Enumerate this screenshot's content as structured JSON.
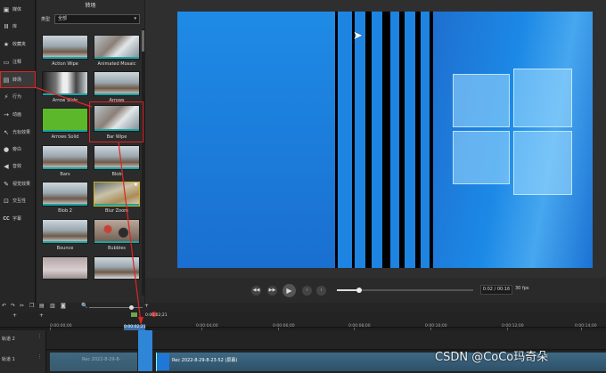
{
  "nav": {
    "items": [
      {
        "icon": "media-icon",
        "glyph": "▣",
        "label": "媒体"
      },
      {
        "icon": "library-icon",
        "glyph": "Ⅲ",
        "label": "库"
      },
      {
        "icon": "favorites-icon",
        "glyph": "★",
        "label": "收藏夹"
      },
      {
        "icon": "annotation-icon",
        "glyph": "▭",
        "label": "注释"
      },
      {
        "icon": "transition-icon",
        "glyph": "▤",
        "label": "转场"
      },
      {
        "icon": "behavior-icon",
        "glyph": "⚡",
        "label": "行为"
      },
      {
        "icon": "animation-icon",
        "glyph": "→",
        "label": "动画"
      },
      {
        "icon": "cursor-effect-icon",
        "glyph": "↖",
        "label": "光标效果"
      },
      {
        "icon": "narration-icon",
        "glyph": "●",
        "label": "旁白"
      },
      {
        "icon": "audio-icon",
        "glyph": "◀",
        "label": "音效"
      },
      {
        "icon": "visual-effect-icon",
        "glyph": "✎",
        "label": "视觉效果"
      },
      {
        "icon": "interactivity-icon",
        "glyph": "⊡",
        "label": "交互性"
      },
      {
        "icon": "captions-icon",
        "glyph": "CC",
        "label": "字幕"
      }
    ]
  },
  "panel": {
    "title": "转场",
    "type_label": "类型",
    "type_value": "全部",
    "tiles": [
      {
        "label": "Action Wipe"
      },
      {
        "label": "Animated Mosaic"
      },
      {
        "label": "Arrow Slide"
      },
      {
        "label": "Arrows"
      },
      {
        "label": "Arrows Solid"
      },
      {
        "label": "Bar Wipe"
      },
      {
        "label": "Bars"
      },
      {
        "label": "Blob"
      },
      {
        "label": "Blob 2"
      },
      {
        "label": "Blur Zoom"
      },
      {
        "label": "Bounce"
      },
      {
        "label": "Bubbles"
      }
    ]
  },
  "transport": {
    "time": "0:02 / 00:16",
    "fps": "30 fps"
  },
  "timeline": {
    "playhead": "0:00:02;21",
    "playhead_short": "0:00:02;21",
    "ruler_ticks": [
      "0:00:00;00",
      "0:00:02;00",
      "0:00:04;00",
      "0:00:06;00",
      "0:00:08;00",
      "0:00:10;00",
      "0:00:12;00",
      "0:00:14;00"
    ],
    "tracks": [
      {
        "name": "轨道 2"
      },
      {
        "name": "轨道 1"
      }
    ],
    "clip_pre_label": "Rec 2022-8-29-8-",
    "clip_main_label": "Rec 2022-8-29-8-23-52 (屏幕)"
  },
  "watermark": "CSDN @CoCo玛奇朵",
  "colors": {
    "accent_red": "#e02424",
    "transition_teal": "#1aa3a3",
    "desktop_blue": "#1f78d8"
  }
}
